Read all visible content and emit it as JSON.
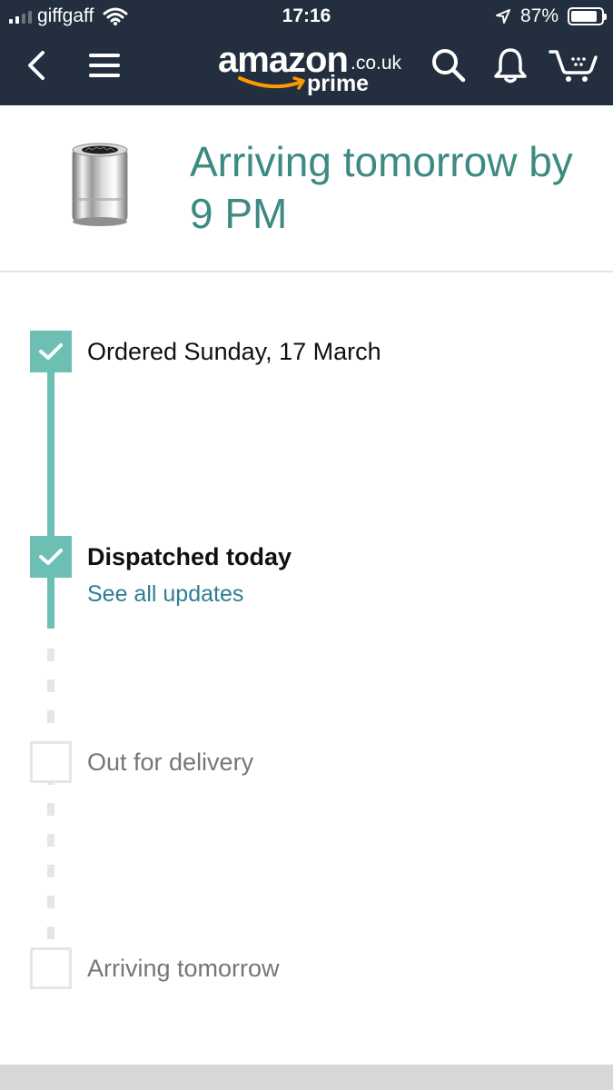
{
  "status_bar": {
    "carrier": "giffgaff",
    "time": "17:16",
    "battery": "87%",
    "battery_level": 0.87
  },
  "nav": {
    "logo_word": "amazon",
    "logo_tld": ".co.uk",
    "logo_prime": "prime",
    "icons": [
      "back-arrow-icon",
      "menu-icon",
      "search-icon",
      "bell-icon",
      "cart-icon"
    ]
  },
  "delivery": {
    "headline": "Arriving tomorrow by 9 PM"
  },
  "timeline": {
    "steps": [
      {
        "label": "Ordered Sunday, 17 March",
        "state": "done"
      },
      {
        "label": "Dispatched today",
        "state": "done",
        "link": "See all updates"
      },
      {
        "label": "Out for delivery",
        "state": "pending"
      },
      {
        "label": "Arriving tomorrow",
        "state": "pending"
      }
    ]
  },
  "colors": {
    "header_bg": "#232f3e",
    "accent_teal": "#6dbfb3",
    "headline_green": "#3c8a82",
    "link_blue": "#2d7f93",
    "smile_orange": "#ff9900"
  }
}
